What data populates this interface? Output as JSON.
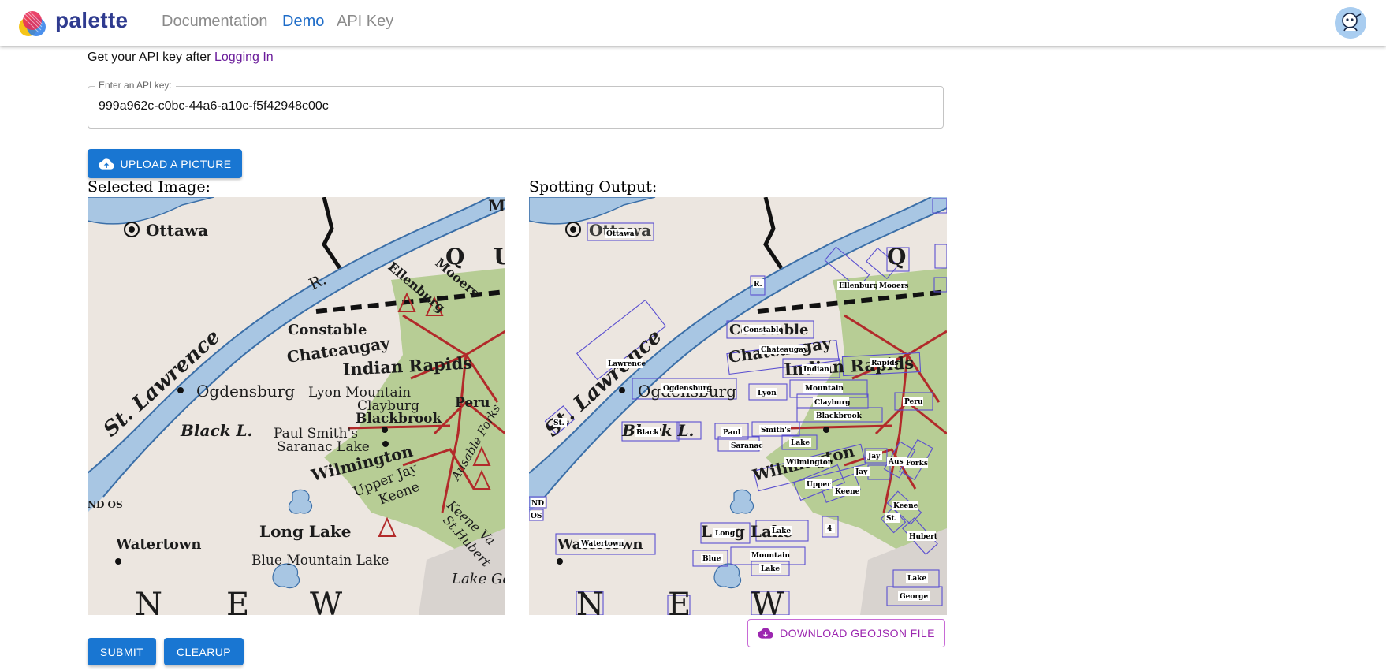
{
  "header": {
    "brand": "palette",
    "nav": [
      {
        "label": "Documentation",
        "active": false
      },
      {
        "label": "Demo",
        "active": true
      },
      {
        "label": "API Key",
        "active": false
      }
    ]
  },
  "api": {
    "intro_text": "Get your API key after",
    "login_link": "Logging In",
    "field_label": "Enter an API key:",
    "field_value": "999a962c-c0bc-44a6-a10c-f5f42948c00c"
  },
  "upload_button": "UPLOAD A PICTURE",
  "selected_image_title": "Selected Image:",
  "spotting_output_title": "Spotting Output:",
  "map_labels": {
    "ottawa": "Ottawa",
    "st_lawrence": "St. Lawrence",
    "r": "R.",
    "ellenburg": "Ellenburg",
    "mooers": "Mooers",
    "constable": "Constable",
    "chateaugay": "Chateaugay",
    "indian_rapids": "Indian Rapids",
    "ogdensburg": "Ogdensburg",
    "lyon_mountain": "Lyon Mountain",
    "clayburg": "Clayburg",
    "blackbrook": "Blackbrook",
    "peru": "Peru",
    "black_l": "Black L.",
    "paul_smiths": "Paul Smith's",
    "saranac_lake": "Saranac Lake",
    "wilmington": "Wilmington",
    "jay": "Jay",
    "upper_jay": "Upper Jay",
    "keene": "Keene",
    "ausable_forks": "Ausable Forks",
    "keene_valley": "Keene Va",
    "st_hubert": "St.Hubert",
    "watertown": "Watertown",
    "long_lake": "Long Lake",
    "blue_mountain_lake": "Blue Mountain Lake",
    "lake_george": "Lake George",
    "nd_os": "ND OS",
    "q": "Q",
    "u": "U",
    "n": "N",
    "e": "E",
    "w": "W",
    "m": "M"
  },
  "spot_labels": {
    "ottawa": "Ottawa",
    "lawrence": "Lawrence",
    "st": "St.",
    "r": "R.",
    "ellenburg": "Ellenburg",
    "mooers": "Mooers",
    "constable": "Constable",
    "chateaugay": "Chateaugay",
    "indian": "Indian",
    "rapids": "Rapids",
    "ogdensburg": "Ogdensburg",
    "lyon": "Lyon",
    "mountain": "Mountain",
    "clayburg": "Clayburg",
    "blackbrook": "Blackbrook",
    "peru": "Peru",
    "black": "Black",
    "paul": "Paul",
    "smiths": "Smith's",
    "saranac": "Saranac",
    "lake": "Lake",
    "wilmington": "Wilmington",
    "jay": "Jay",
    "jay2": "Jay",
    "upper": "Upper",
    "keene": "Keene",
    "aus": "Aus",
    "forks": "Forks",
    "keene2": "Keene",
    "st2": "St.",
    "hubert": "Hubert",
    "watertown": "Watertown",
    "long": "Long",
    "lake2": "Lake",
    "blue": "Blue",
    "mountain2": "Mountain",
    "lake3": "Lake",
    "lake4": "Lake",
    "george": "George",
    "nd": "ND",
    "os": "OS",
    "four": "4"
  },
  "buttons": {
    "submit": "SUBMIT",
    "clearup": "CLEARUP",
    "download": "DOWNLOAD GEOJSON FILE"
  },
  "colors": {
    "primary": "#1976d2",
    "secondary": "#9c27b0",
    "brand": "#2f3b8f"
  }
}
